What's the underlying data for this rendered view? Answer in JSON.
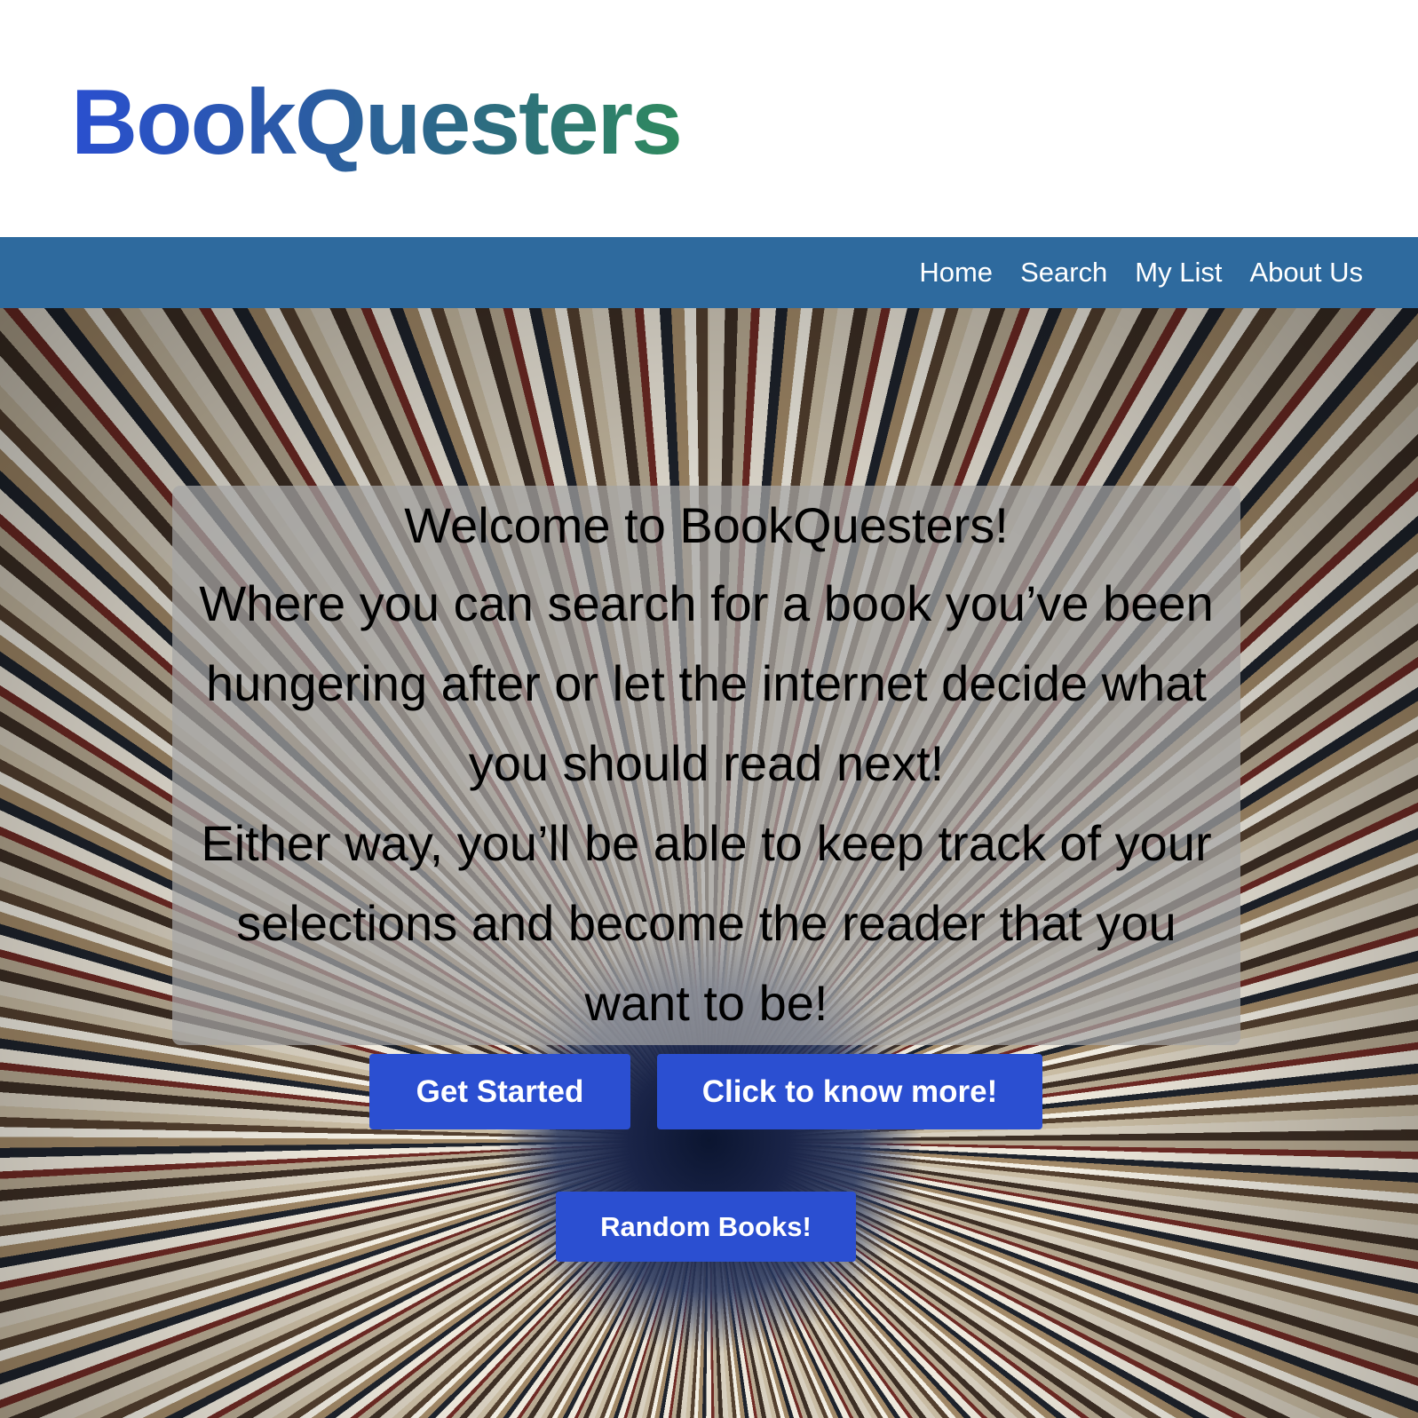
{
  "header": {
    "logo_text": "BookQuesters"
  },
  "nav": {
    "items": [
      {
        "label": "Home"
      },
      {
        "label": "Search"
      },
      {
        "label": "My List"
      },
      {
        "label": "About Us"
      }
    ]
  },
  "hero": {
    "title": "Welcome to BookQuesters!",
    "line1": "Where you can search for a book you’ve been hungering after or let the internet decide what you should read next!",
    "line2": "Either way, you’ll be able to keep track of your selections and become the reader that you want to be!"
  },
  "buttons": {
    "get_started": "Get Started",
    "know_more": "Click to know more!",
    "random_books": "Random Books!"
  },
  "colors": {
    "nav_bg": "#2e6a9e",
    "button_bg": "#2b4fd1",
    "logo_gradient_start": "#2a4fcf",
    "logo_gradient_end": "#2f8a5e"
  }
}
